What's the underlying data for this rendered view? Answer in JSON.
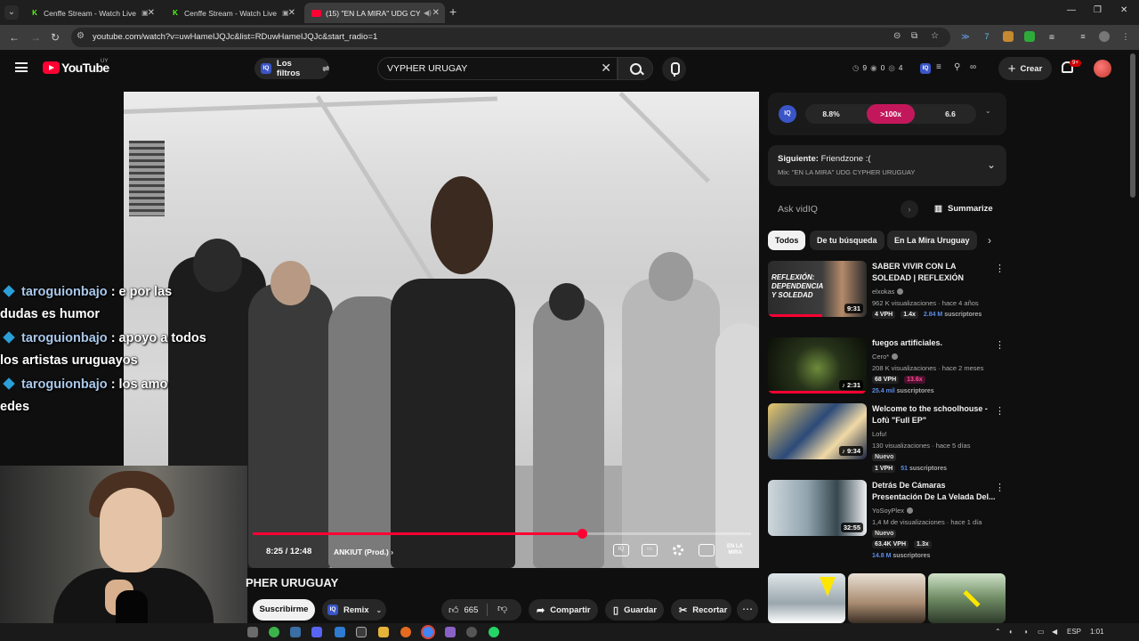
{
  "browser": {
    "tabs": [
      {
        "title": "Cenffe Stream - Watch Live",
        "icon": "kick-icon"
      },
      {
        "title": "Cenffe Stream - Watch Live",
        "icon": "kick-icon"
      },
      {
        "title": "(15) \"EN LA MIRA\" UDG CY",
        "icon": "youtube-icon"
      }
    ],
    "url": "youtube.com/watch?v=uwHameIJQJc&list=RDuwHameIJQJc&start_radio=1"
  },
  "header": {
    "logo_text": "YouTube",
    "country": "UY",
    "filters_label": "Los filtros",
    "search_value": "VYPHER URUGAY",
    "stats": [
      "9",
      "0",
      "4"
    ],
    "create_label": "Crear",
    "notifications": "9+"
  },
  "player": {
    "time": "8:25 / 12:48",
    "chapter": "ANKIUT (Prod.)",
    "progress": 0.66,
    "watermark": "EN LA MIRA"
  },
  "chat": [
    {
      "user": "taroguionbajo",
      "message": ": e por las dudas es humor",
      "first": ": e por las",
      "second": "dudas es humor"
    },
    {
      "user": "taroguionbajo",
      "message": ": apoyo a todos los artistas uruguayos",
      "first": ": apoyo a todos",
      "second": "los artistas uruguayos"
    },
    {
      "user": "taroguionbajo",
      "message": ": los amo",
      "first": ": los amo",
      "second": "edes"
    }
  ],
  "video": {
    "title": "PHER URUGUAY",
    "subscribe_label": "Suscribirme",
    "remix_label": "Remix",
    "likes": "665",
    "share_label": "Compartir",
    "save_label": "Guardar",
    "clip_label": "Recortar"
  },
  "vidiq": {
    "metrics": [
      "8.8%",
      ">100x",
      "6.6"
    ]
  },
  "next_up": {
    "label": "Siguiente:",
    "title": "Friendzone :(",
    "mix": "Mix: \"EN LA MIRA\" UDG CYPHER URUGUAY"
  },
  "ask": {
    "placeholder": "Ask vidIQ",
    "summarize_label": "Summarize"
  },
  "chips": [
    "Todos",
    "De tu búsqueda",
    "En La Mira Uruguay"
  ],
  "recommendations": [
    {
      "title": "SABER VIVIR CON LA SOLEDAD | REFLEXIÓN",
      "channel": "elxokas",
      "views": "962 K visualizaciones · hace 4 años",
      "duration": "9:31",
      "vph": "4 VPH",
      "mult": "1.4x",
      "subs": "2.84 M",
      "subs_label": "suscriptores",
      "thumb_text": "REFLEXIÓN: DEPENDENCIA Y SOLEDAD",
      "progress": 0.55
    },
    {
      "title": "fuegos artificiales.",
      "channel": "Cero*",
      "views": "208 K visualizaciones · hace 2 meses",
      "duration": "2:31",
      "vph": "68 VPH",
      "mult": "13.6x",
      "subs": "25.4 mil",
      "subs_label": "suscriptores",
      "progress": 0.98
    },
    {
      "title": "Welcome to the schoolhouse - Lofû \"Full EP\"",
      "channel": "Lofu!",
      "views": "130 visualizaciones · hace 5 días",
      "duration": "9:34",
      "tag": "Nuevo",
      "vph": "1 VPH",
      "subs": "51",
      "subs_label": "suscriptores"
    },
    {
      "title": "Detrás De Cámaras Presentación De La Velada Del...",
      "channel": "YoSoyPlex",
      "views": "1,4 M de visualizaciones · hace 1 día",
      "duration": "32:55",
      "tag": "Nuevo",
      "vph": "63.4K VPH",
      "mult": "1.3x",
      "subs": "14.8 M",
      "subs_label": "suscriptores"
    }
  ],
  "taskbar": {
    "lang": "ESP",
    "time": "1:01"
  }
}
